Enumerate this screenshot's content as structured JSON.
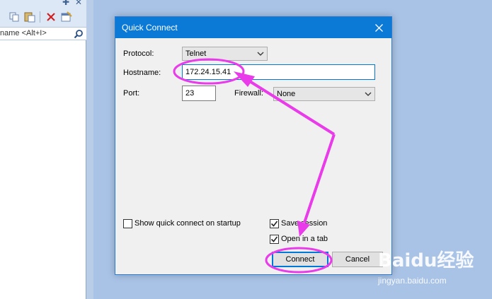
{
  "background_app": {
    "search_placeholder": "name <Alt+I>"
  },
  "dialog": {
    "title": "Quick Connect",
    "protocol_label": "Protocol:",
    "protocol_value": "Telnet",
    "hostname_label": "Hostname:",
    "hostname_value": "172.24.15.41",
    "port_label": "Port:",
    "port_value": "23",
    "firewall_label": "Firewall:",
    "firewall_value": "None",
    "show_on_startup_label": "Show quick connect on startup",
    "show_on_startup_checked": false,
    "save_session_label": "Save session",
    "save_session_checked": true,
    "open_in_tab_label": "Open in a tab",
    "open_in_tab_checked": true,
    "connect_label": "Connect",
    "cancel_label": "Cancel"
  },
  "annotation": {
    "color": "#e93be9"
  },
  "watermark": {
    "brand": "Baidu经验",
    "url": "jingyan.baidu.com"
  },
  "colors": {
    "titlebar": "#0b7ad6",
    "desktop": "#a9c3e6"
  }
}
